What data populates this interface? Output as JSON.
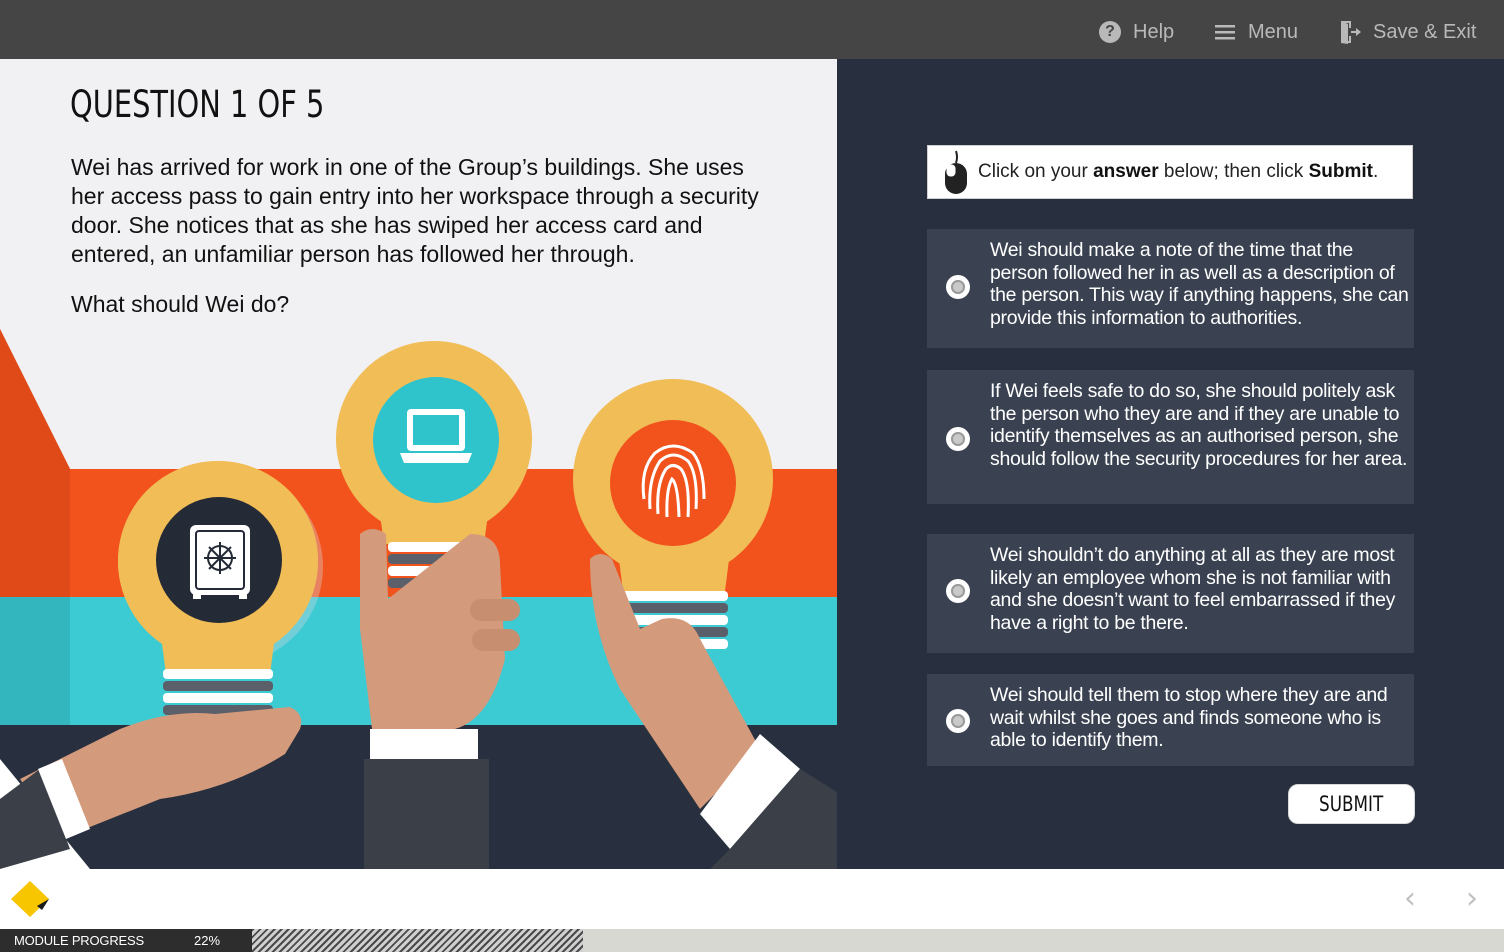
{
  "topbar": {
    "help_label": "Help",
    "menu_label": "Menu",
    "save_exit_label": "Save & Exit"
  },
  "question": {
    "title": "QUESTION 1 OF 5",
    "body": "Wei has arrived for work in one of the Group’s buildings. She uses her access pass to gain entry into her workspace through a security door. She notices that as she has swiped her access card and entered, an unfamiliar person has followed her through.",
    "prompt": "What should Wei do?"
  },
  "instruction": {
    "part1": "Click on your ",
    "bold1": "answer",
    "part2": " below; then click ",
    "bold2": "Submit",
    "part3": "."
  },
  "options": [
    {
      "text": "Wei should make a note of the time that the person followed her in as well as a description of the person. This way if anything happens, she can provide this information to authorities."
    },
    {
      "text": "If Wei feels safe to do so, she should politely ask the person who they are and if they are unable to identify themselves as an authorised person, she should follow the security procedures for her area."
    },
    {
      "text": "Wei shouldn’t do anything at all as they are most likely an employee whom she is not familiar with and she doesn’t want to feel embarrassed if they have a right to be there."
    },
    {
      "text": "Wei should tell them to stop where they are and wait whilst she goes and finds someone who is able to identify them."
    }
  ],
  "submit_label": "SUBMIT",
  "footer": {
    "prev_icon": "chevron-left-icon",
    "next_icon": "chevron-right-icon",
    "logo_color": "#f7c600"
  },
  "progress": {
    "label": "MODULE PROGRESS",
    "value_text": "22%",
    "fraction": 0.22
  },
  "colors": {
    "topbar": "#454545",
    "right_panel": "#28303f",
    "option_bg": "#3a4251"
  }
}
